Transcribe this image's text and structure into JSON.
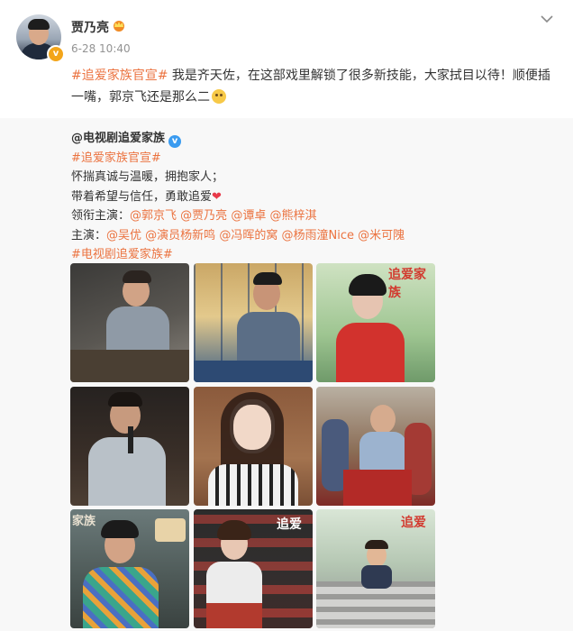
{
  "post": {
    "author": "贾乃亮",
    "time": "6-28 10:40",
    "topic": "#追爱家族官宣#",
    "text_part1": " 我是齐天佐，在这部戏里解锁了很多新技能，大家拭目以待！顺便插一嘴，郭京飞还是那么二",
    "verified_badge": "v",
    "icons": [
      "crown-icon",
      "chevron-down-icon",
      "laughing-emoji-icon"
    ]
  },
  "repost": {
    "author": "@电视剧追爱家族",
    "verified_badge": "v",
    "topic1": "#追爱家族官宣#",
    "line1": "怀揣真诚与温暖，拥抱家人；",
    "line2": "带着希望与信任，勇敢追爱",
    "lead_label": "领衔主演：",
    "lead_cast": [
      "@郭京飞",
      "@贾乃亮",
      "@谭卓",
      "@熊梓淇"
    ],
    "main_label": "主演：",
    "main_cast": [
      "@吴优",
      "@演员杨新鸣",
      "@冯晖的窝",
      "@杨雨潼Nice",
      "@米可隗"
    ],
    "topic2": "#电视剧追爱家族#",
    "photos": [
      "photo-man-sofa",
      "photo-man-window",
      "photo-woman-red",
      "photo-man-microphone",
      "photo-woman-smiling",
      "photo-family-table",
      "photo-woman-praying",
      "photo-girl-bleachers",
      "photo-boy-steps"
    ]
  },
  "colors": {
    "topic": "#eb7340",
    "verified_blue": "#3a9bf0",
    "verified_orange": "#f3a51a",
    "repost_bg": "#f8f8f8"
  }
}
